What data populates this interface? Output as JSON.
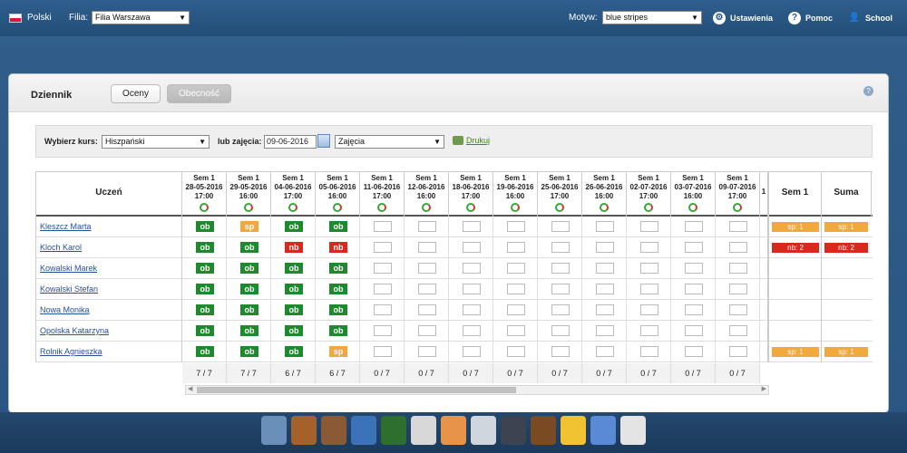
{
  "topbar": {
    "language": "Polski",
    "filia_label": "Filia:",
    "filia_value": "Filia Warszawa",
    "motyw_label": "Motyw:",
    "motyw_value": "blue stripes",
    "settings": "Ustawienia",
    "help": "Pomoc",
    "user": "School"
  },
  "panel": {
    "title": "Dziennik",
    "tab_grades": "Oceny",
    "tab_attendance": "Obecność"
  },
  "filter": {
    "course_label": "Wybierz kurs:",
    "course_value": "Hiszpański",
    "date_label": "lub zajęcia:",
    "date_value": "09-06-2016",
    "lesson_value": "Zajęcia",
    "print": "Drukuj"
  },
  "table": {
    "student_header": "Uczeń",
    "sem_header": "Sem 1",
    "sum_header": "Suma",
    "columns": [
      {
        "sem": "Sem 1",
        "date": "28-05-2016",
        "time": "17:00"
      },
      {
        "sem": "Sem 1",
        "date": "29-05-2016",
        "time": "16:00"
      },
      {
        "sem": "Sem 1",
        "date": "04-06-2016",
        "time": "17:00"
      },
      {
        "sem": "Sem 1",
        "date": "05-06-2016",
        "time": "16:00"
      },
      {
        "sem": "Sem 1",
        "date": "11-06-2016",
        "time": "17:00"
      },
      {
        "sem": "Sem 1",
        "date": "12-06-2016",
        "time": "16:00"
      },
      {
        "sem": "Sem 1",
        "date": "18-06-2016",
        "time": "17:00"
      },
      {
        "sem": "Sem 1",
        "date": "19-06-2016",
        "time": "16:00"
      },
      {
        "sem": "Sem 1",
        "date": "25-06-2016",
        "time": "17:00"
      },
      {
        "sem": "Sem 1",
        "date": "26-06-2016",
        "time": "16:00"
      },
      {
        "sem": "Sem 1",
        "date": "02-07-2016",
        "time": "17:00"
      },
      {
        "sem": "Sem 1",
        "date": "03-07-2016",
        "time": "16:00"
      },
      {
        "sem": "Sem 1",
        "date": "09-07-2016",
        "time": "17:00"
      }
    ],
    "partial_column_label": "1",
    "students": [
      {
        "name": "Kleszcz Marta",
        "marks": [
          "ob",
          "sp",
          "ob",
          "ob",
          "",
          "",
          "",
          "",
          "",
          "",
          "",
          "",
          ""
        ],
        "sem": "sp: 1",
        "sum": "sp: 1",
        "sum_type": "sp"
      },
      {
        "name": "Kloch Karol",
        "marks": [
          "ob",
          "ob",
          "nb",
          "nb",
          "",
          "",
          "",
          "",
          "",
          "",
          "",
          "",
          ""
        ],
        "sem": "nb: 2",
        "sum": "nb: 2",
        "sum_type": "nb"
      },
      {
        "name": "Kowalski Marek",
        "marks": [
          "ob",
          "ob",
          "ob",
          "ob",
          "",
          "",
          "",
          "",
          "",
          "",
          "",
          "",
          ""
        ],
        "sem": "",
        "sum": "",
        "sum_type": ""
      },
      {
        "name": "Kowalski Stefan",
        "marks": [
          "ob",
          "ob",
          "ob",
          "ob",
          "",
          "",
          "",
          "",
          "",
          "",
          "",
          "",
          ""
        ],
        "sem": "",
        "sum": "",
        "sum_type": ""
      },
      {
        "name": "Nowa Monika",
        "marks": [
          "ob",
          "ob",
          "ob",
          "ob",
          "",
          "",
          "",
          "",
          "",
          "",
          "",
          "",
          ""
        ],
        "sem": "",
        "sum": "",
        "sum_type": ""
      },
      {
        "name": "Opolska Katarzyna",
        "marks": [
          "ob",
          "ob",
          "ob",
          "ob",
          "",
          "",
          "",
          "",
          "",
          "",
          "",
          "",
          ""
        ],
        "sem": "",
        "sum": "",
        "sum_type": ""
      },
      {
        "name": "Rolnik Agnieszka",
        "marks": [
          "ob",
          "ob",
          "ob",
          "sp",
          "",
          "",
          "",
          "",
          "",
          "",
          "",
          "",
          ""
        ],
        "sem": "sp: 1",
        "sum": "sp: 1",
        "sum_type": "sp"
      }
    ],
    "counts": [
      "7 / 7",
      "7 / 7",
      "6 / 7",
      "6 / 7",
      "0 / 7",
      "0 / 7",
      "0 / 7",
      "0 / 7",
      "0 / 7",
      "0 / 7",
      "0 / 7",
      "0 / 7",
      "0 / 7"
    ]
  },
  "dock": {
    "icons": [
      "dashboard-icon",
      "teacher-icon",
      "graduate-icon",
      "math-icon",
      "blackboard-icon",
      "clock-icon",
      "piggy-bank-icon",
      "calendar-icon",
      "users-icon",
      "door-icon",
      "mail-icon",
      "books-icon",
      "report-icon"
    ],
    "colors": [
      "#6a8fb8",
      "#a5612a",
      "#8a5a34",
      "#3b72b8",
      "#2e6e2e",
      "#d8d8d8",
      "#e8934a",
      "#cfd6dd",
      "#3b4450",
      "#7a4a22",
      "#f1c232",
      "#5a8ad6",
      "#e4e4e4"
    ]
  }
}
